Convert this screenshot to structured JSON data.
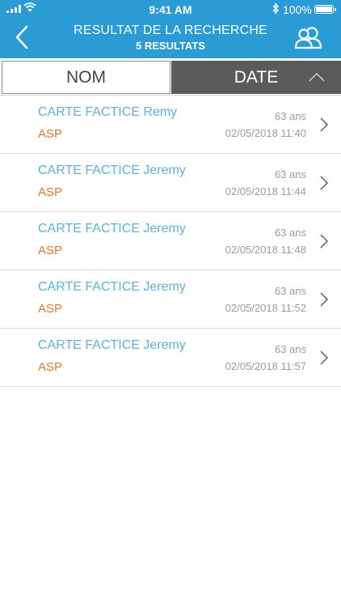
{
  "status_bar": {
    "time": "9:41 AM",
    "battery": "100%"
  },
  "header": {
    "title": "RESULTAT DE LA RECHERCHE",
    "subtitle": "5 RESULTATS"
  },
  "sort": {
    "tab_name": "NOM",
    "tab_date": "DATE",
    "active": "DATE",
    "direction": "ascending"
  },
  "colors": {
    "header_bg": "#2b9bd6",
    "name_text": "#5db1d9",
    "type_text": "#e0792d",
    "active_tab_bg": "#5b5b5b"
  },
  "results": [
    {
      "name": "CARTE FACTICE Remy",
      "type": "ASP",
      "age": "63 ans",
      "datetime": "02/05/2018 11:40"
    },
    {
      "name": "CARTE FACTICE Jeremy",
      "type": "ASP",
      "age": "63 ans",
      "datetime": "02/05/2018 11:44"
    },
    {
      "name": "CARTE FACTICE Jeremy",
      "type": "ASP",
      "age": "63 ans",
      "datetime": "02/05/2018 11:48"
    },
    {
      "name": "CARTE FACTICE Jeremy",
      "type": "ASP",
      "age": "63 ans",
      "datetime": "02/05/2018 11:52"
    },
    {
      "name": "CARTE FACTICE Jeremy",
      "type": "ASP",
      "age": "63 ans",
      "datetime": "02/05/2018 11:57"
    }
  ]
}
